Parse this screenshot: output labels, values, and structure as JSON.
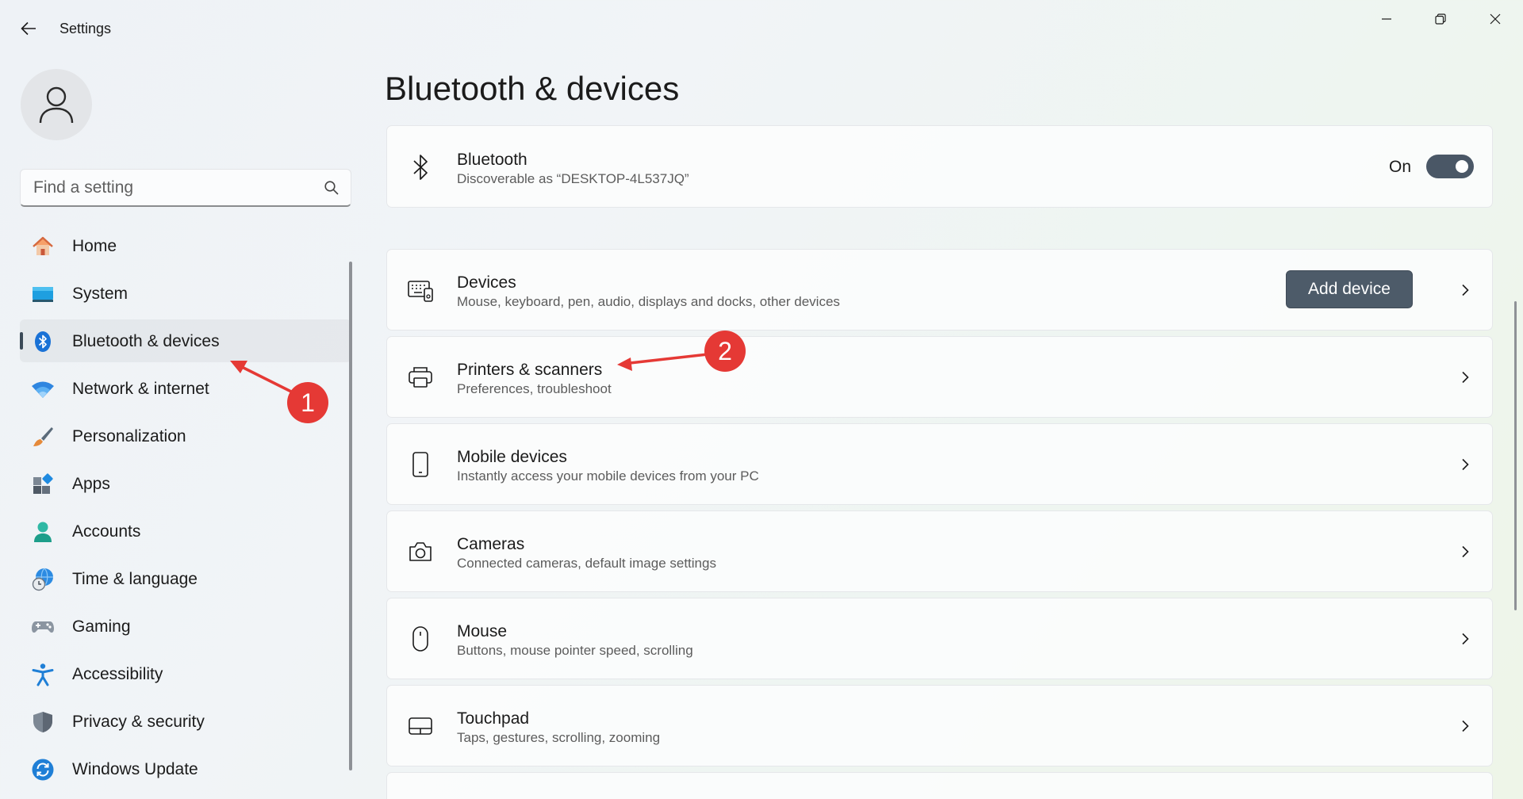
{
  "window": {
    "title": "Settings",
    "back_icon": "arrow-left-icon",
    "controls": [
      "minimize-icon",
      "restore-icon",
      "close-icon"
    ]
  },
  "search": {
    "placeholder": "Find a setting",
    "value": ""
  },
  "sidebar": {
    "items": [
      {
        "label": "Home",
        "icon": "home-icon",
        "active": false
      },
      {
        "label": "System",
        "icon": "monitor-icon",
        "active": false
      },
      {
        "label": "Bluetooth & devices",
        "icon": "bluetooth-icon",
        "active": true
      },
      {
        "label": "Network & internet",
        "icon": "wifi-icon",
        "active": false
      },
      {
        "label": "Personalization",
        "icon": "paintbrush-icon",
        "active": false
      },
      {
        "label": "Apps",
        "icon": "apps-icon",
        "active": false
      },
      {
        "label": "Accounts",
        "icon": "person-icon",
        "active": false
      },
      {
        "label": "Time & language",
        "icon": "globe-clock-icon",
        "active": false
      },
      {
        "label": "Gaming",
        "icon": "gamepad-icon",
        "active": false
      },
      {
        "label": "Accessibility",
        "icon": "accessibility-icon",
        "active": false
      },
      {
        "label": "Privacy & security",
        "icon": "shield-icon",
        "active": false
      },
      {
        "label": "Windows Update",
        "icon": "update-icon",
        "active": false
      }
    ]
  },
  "main": {
    "title": "Bluetooth & devices",
    "bluetooth": {
      "title": "Bluetooth",
      "subtitle": "Discoverable as “DESKTOP-4L537JQ”",
      "toggle_label": "On",
      "toggle_on": true
    },
    "devices": {
      "title": "Devices",
      "subtitle": "Mouse, keyboard, pen, audio, displays and docks, other devices",
      "button": "Add device"
    },
    "rows": [
      {
        "title": "Printers & scanners",
        "subtitle": "Preferences, troubleshoot",
        "icon": "printer-icon"
      },
      {
        "title": "Mobile devices",
        "subtitle": "Instantly access your mobile devices from your PC",
        "icon": "phone-icon"
      },
      {
        "title": "Cameras",
        "subtitle": "Connected cameras, default image settings",
        "icon": "camera-icon"
      },
      {
        "title": "Mouse",
        "subtitle": "Buttons, mouse pointer speed, scrolling",
        "icon": "mouse-icon"
      },
      {
        "title": "Touchpad",
        "subtitle": "Taps, gestures, scrolling, zooming",
        "icon": "touchpad-icon"
      }
    ]
  },
  "annotations": {
    "marker_1": "1",
    "marker_2": "2",
    "color": "#e53935"
  }
}
